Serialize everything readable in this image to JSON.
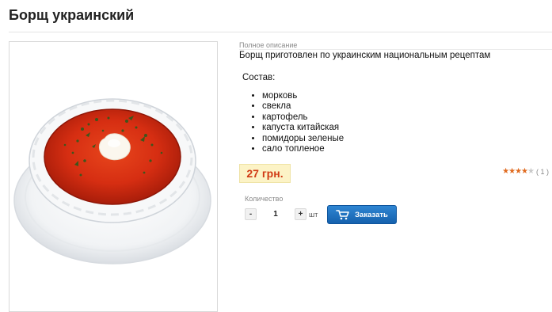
{
  "product": {
    "title": "Борщ украинский"
  },
  "description": {
    "heading": "Полное описание",
    "text": "Борщ приготовлен по украинским национальным рецептам",
    "composition_label": "Состав:",
    "ingredients": [
      "морковь",
      "свекла",
      "картофель",
      "капуста китайская",
      "помидоры зеленые",
      "сало топленое"
    ]
  },
  "price": {
    "value": "27 грн."
  },
  "rating": {
    "stars": 4,
    "max": 5,
    "count": "( 1 )"
  },
  "order": {
    "quantity_label": "Количество",
    "minus_label": "-",
    "plus_label": "+",
    "quantity": "1",
    "unit": "шт",
    "button_label": "Заказать"
  },
  "colors": {
    "price_text": "#d03a14",
    "price_bg": "#fcf3c6",
    "button_blue": "#1f73c2",
    "star_orange": "#e06a1f"
  }
}
